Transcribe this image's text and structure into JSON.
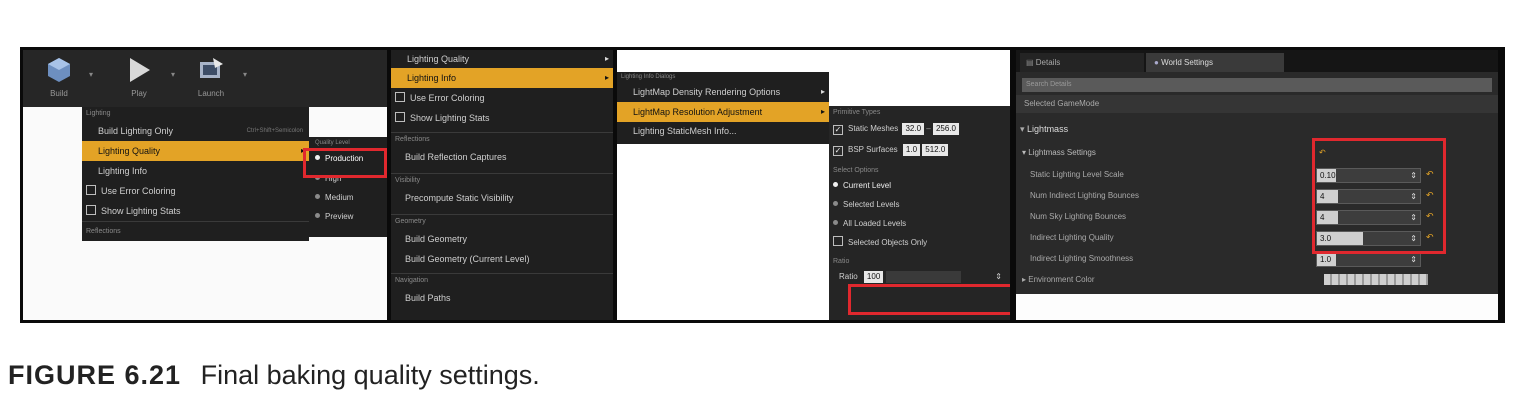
{
  "panel1": {
    "toolbar": {
      "build_label": "Build",
      "play_label": "Play",
      "launch_label": "Launch"
    },
    "menu": {
      "section_lighting": "Lighting",
      "build_lighting_only": "Build Lighting Only",
      "build_lighting_shortcut": "Ctrl+Shift+Semicolon",
      "lighting_quality": "Lighting Quality",
      "lighting_info": "Lighting Info",
      "use_error_coloring": "Use Error Coloring",
      "show_lighting_stats": "Show Lighting Stats",
      "section_reflections": "Reflections"
    },
    "quality": {
      "header": "Quality Level",
      "options": [
        "Production",
        "High",
        "Medium",
        "Preview"
      ],
      "selected": "Production"
    }
  },
  "panel2": {
    "items": {
      "lighting_quality": "Lighting Quality",
      "lighting_info": "Lighting Info",
      "use_error_coloring": "Use Error Coloring",
      "show_lighting_stats": "Show Lighting Stats",
      "section_reflections": "Reflections",
      "build_reflection_captures": "Build Reflection Captures",
      "section_visibility": "Visibility",
      "precompute_static_visibility": "Precompute Static Visibility",
      "section_geometry": "Geometry",
      "build_geometry": "Build Geometry",
      "build_geometry_current": "Build Geometry (Current Level)",
      "section_navigation": "Navigation",
      "build_paths": "Build Paths"
    }
  },
  "panel3": {
    "submenu": {
      "header": "Lighting Info Dialogs",
      "density": "LightMap Density Rendering Options",
      "resolution": "LightMap Resolution Adjustment",
      "static_mesh_info": "Lighting StaticMesh Info..."
    },
    "adjust": {
      "primitive_types": "Primitive Types",
      "static_meshes": "Static Meshes",
      "static_min": "32.0",
      "static_max": "256.0",
      "bsp_surfaces": "BSP Surfaces",
      "bsp_min": "1.0",
      "bsp_max": "512.0",
      "select_options": "Select Options",
      "options": [
        "Current Level",
        "Selected Levels",
        "All Loaded Levels",
        "Selected Objects Only"
      ],
      "selected": "Current Level",
      "ratio_header": "Ratio",
      "ratio_label": "Ratio",
      "ratio_value": "100"
    }
  },
  "panel4": {
    "tab_details": "Details",
    "tab_world": "World Settings",
    "search_placeholder": "Search Details",
    "selected_gamemode": "Selected GameMode",
    "lightmass": "Lightmass",
    "lightmass_settings": "Lightmass Settings",
    "rows": [
      {
        "label": "Static Lighting Level Scale",
        "value": "0.10",
        "fill": 0.1
      },
      {
        "label": "Num Indirect Lighting Bounces",
        "value": "4",
        "fill": 0.2
      },
      {
        "label": "Num Sky Lighting Bounces",
        "value": "4",
        "fill": 0.2
      },
      {
        "label": "Indirect Lighting Quality",
        "value": "3.0",
        "fill": 0.45
      },
      {
        "label": "Indirect Lighting Smoothness",
        "value": "1.0",
        "fill": 0.0
      }
    ],
    "environment_color": "Environment Color"
  },
  "caption": {
    "label": "FIGURE 6.21",
    "text": "Final baking quality settings."
  },
  "colors": {
    "accent": "#e3a326",
    "highlight_box": "#e0282e",
    "menu_bg": "#1f1f1f"
  }
}
